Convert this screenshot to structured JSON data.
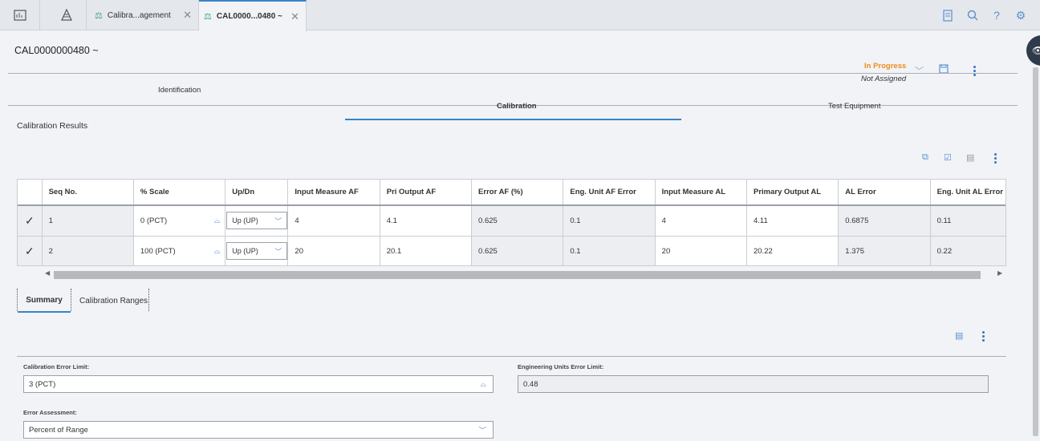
{
  "top_tabs": [
    {
      "label": "Calibra...agement",
      "icon": "scale-icon"
    },
    {
      "label": "CAL0000...0480 ~",
      "icon": "scale-icon",
      "active": true
    }
  ],
  "record": {
    "title": "CAL0000000480 ~",
    "status": "In Progress",
    "assignee": "Not Assigned"
  },
  "sections": {
    "identification": "Identification",
    "calibration": "Calibration",
    "test_equipment": "Test Equipment"
  },
  "calibration_results_label": "Calibration Results",
  "grid": {
    "columns": [
      "Seq No.",
      "% Scale",
      "Up/Dn",
      "Input Measure AF",
      "Pri Output AF",
      "Error AF (%)",
      "Eng. Unit AF Error",
      "Input Measure AL",
      "Primary Output AL",
      "AL Error",
      "Eng. Unit AL Error"
    ],
    "rows": [
      {
        "seq": "1",
        "scale": "0 (PCT)",
        "updn": "Up (UP)",
        "in_af": "4",
        "out_af": "4.1",
        "err_af": "0.625",
        "eng_af": "0.1",
        "in_al": "4",
        "out_al": "4.11",
        "al_err": "0.6875",
        "eng_al": "0.11"
      },
      {
        "seq": "2",
        "scale": "100 (PCT)",
        "updn": "Up (UP)",
        "in_af": "20",
        "out_af": "20.1",
        "err_af": "0.625",
        "eng_af": "0.1",
        "in_al": "20",
        "out_al": "20.22",
        "al_err": "1.375",
        "eng_al": "0.22"
      }
    ]
  },
  "sub_tabs": {
    "summary": "Summary",
    "ranges": "Calibration Ranges"
  },
  "summary": {
    "cal_error_limit_label": "Calibration Error Limit:",
    "cal_error_limit_value": "3 (PCT)",
    "eng_units_limit_label": "Engineering Units Error Limit:",
    "eng_units_limit_value": "0.48",
    "error_assessment_label": "Error Assessment:",
    "error_assessment_value": "Percent of Range"
  },
  "colors": {
    "accent": "#3a83c7",
    "status": "#f08c1a"
  }
}
